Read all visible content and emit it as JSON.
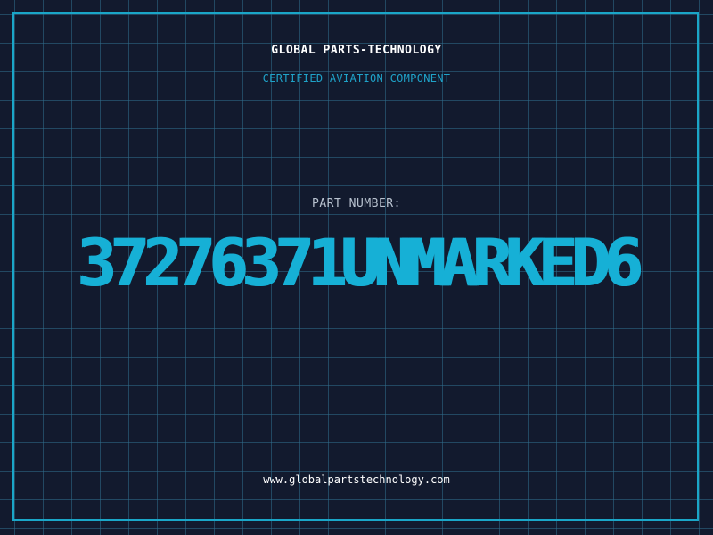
{
  "header": {
    "company": "GLOBAL PARTS-TECHNOLOGY",
    "subtitle": "CERTIFIED AVIATION COMPONENT"
  },
  "part": {
    "label": "PART NUMBER:",
    "number": "37276371UNMARKED6"
  },
  "footer": {
    "url": "www.globalpartstechnology.com"
  },
  "colors": {
    "background": "#121a2e",
    "grid": "#306e8c",
    "accent": "#16b0d6",
    "text": "#ffffff",
    "muted": "#b8c2cf"
  }
}
